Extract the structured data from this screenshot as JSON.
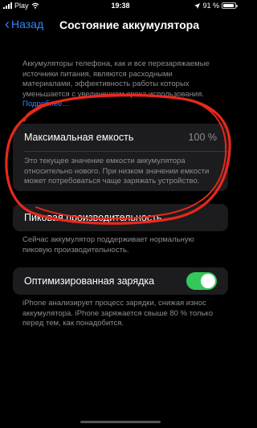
{
  "status_bar": {
    "carrier": "Play",
    "time": "19:38",
    "battery_text": "91 %",
    "battery_level": 0.91
  },
  "nav": {
    "back_label": "Назад",
    "title": "Состояние аккумулятора"
  },
  "intro": {
    "text": "Аккумуляторы телефона, как и все перезаряжаемые источники питания, являются расходными материалами, эффективность работы которых уменьшается с увеличением срока использования.",
    "link": "Подробнее…"
  },
  "max_capacity": {
    "label": "Максимальная емкость",
    "value": "100 %",
    "description": "Это текущее значение емкости аккумулятора относительно нового. При низком значении емкости может потребоваться чаще заряжать устройство."
  },
  "peak_performance": {
    "label": "Пиковая производительность",
    "description": "Сейчас аккумулятор поддерживает нормальную пиковую производительность."
  },
  "optimized_charging": {
    "label": "Оптимизированная зарядка",
    "enabled": true,
    "description": "iPhone анализирует процесс зарядки, снижая износ аккумулятора. iPhone заряжается свыше 80 % только перед тем, как понадобится."
  },
  "colors": {
    "accent": "#2f86ff",
    "toggle_on": "#34c759",
    "annotation": "#e8281c",
    "cell_background": "#1c1c1e",
    "secondary_text": "#8d8d93"
  }
}
